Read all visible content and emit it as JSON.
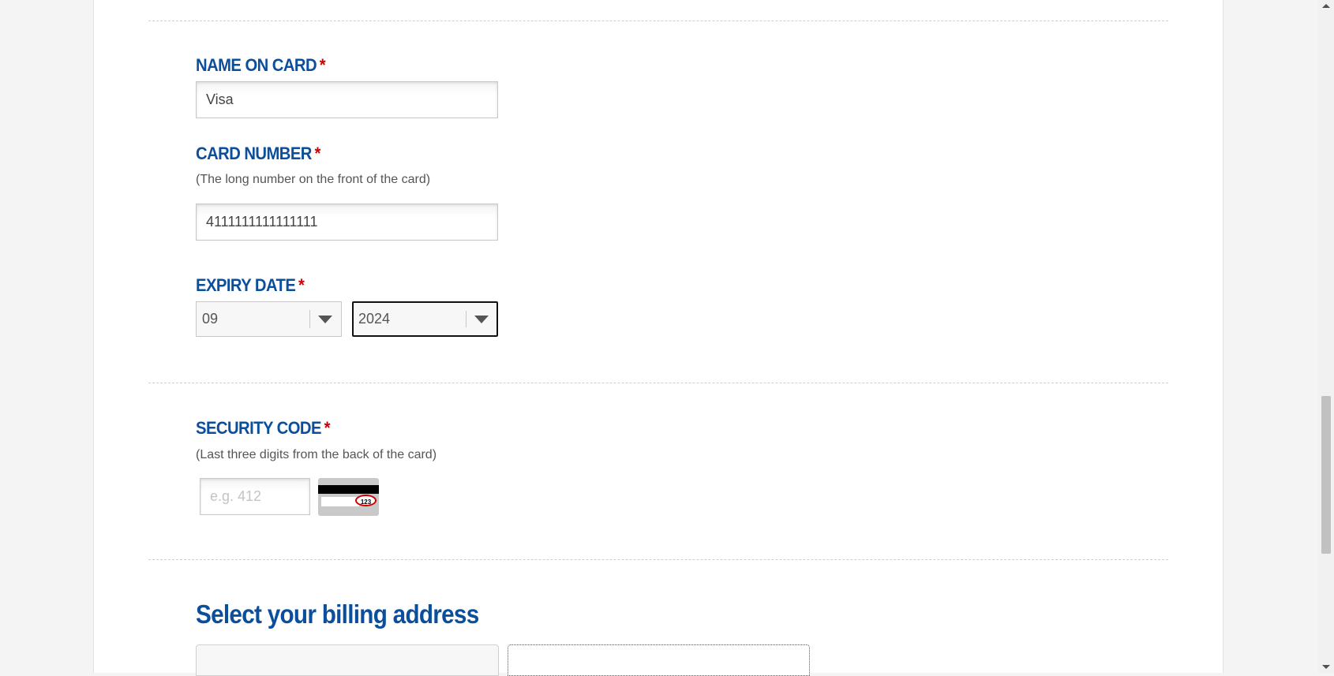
{
  "name_on_card": {
    "label": "NAME ON CARD",
    "required_mark": "*",
    "value": "Visa"
  },
  "card_number": {
    "label": "CARD NUMBER",
    "required_mark": "*",
    "hint": "(The long number on the front of the card)",
    "value": "4111111111111111"
  },
  "expiry_date": {
    "label": "EXPIRY DATE",
    "required_mark": "*",
    "month": "09",
    "year": "2024"
  },
  "security_code": {
    "label": "SECURITY CODE",
    "required_mark": "*",
    "hint": "(Last three digits from the back of the card)",
    "placeholder": "e.g. 412",
    "image_text": "123"
  },
  "billing": {
    "title": "Select your billing address"
  },
  "colors": {
    "label_blue": "#0b4f9c",
    "required_red": "#cc0000"
  }
}
